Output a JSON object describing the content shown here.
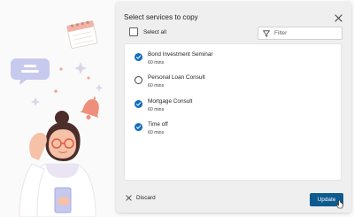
{
  "dialog": {
    "title": "Select services to copy",
    "close_icon": "close-icon",
    "select_all_label": "Select all",
    "filter_placeholder": "Filter",
    "discard_label": "Discard",
    "update_label": "Update"
  },
  "services": [
    {
      "name": "Bond Investment Seminar",
      "duration": "60 mins",
      "selected": true
    },
    {
      "name": "Personal Loan Consult",
      "duration": "60 mins",
      "selected": false
    },
    {
      "name": "Mortgage Consult",
      "duration": "60 mins",
      "selected": true
    },
    {
      "name": "Time off",
      "duration": "60 mins",
      "selected": true
    }
  ],
  "colors": {
    "accent": "#0f6cbd",
    "update_button": "#0f5a8f",
    "dialog_bg": "#efefef",
    "page_bg": "#fafafa"
  }
}
